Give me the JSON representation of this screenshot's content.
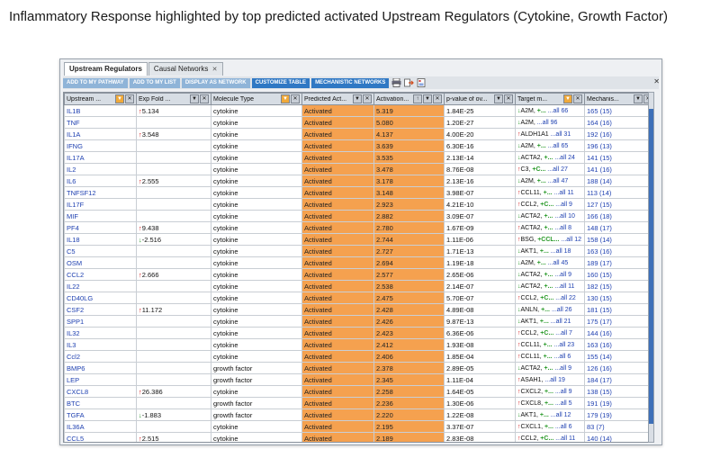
{
  "slide_title": "Inflammatory Response highlighted by top predicted activated Upstream Regulators (Cytokine, Growth Factor)",
  "tabs": [
    {
      "label": "Upstream Regulators",
      "active": true
    },
    {
      "label": "Causal Networks",
      "active": false
    }
  ],
  "tab_close_glyph": "✕",
  "toolbar": {
    "buttons": [
      {
        "label": "ADD TO MY PATHWAY",
        "enabled": false
      },
      {
        "label": "ADD TO MY LIST",
        "enabled": false
      },
      {
        "label": "DISPLAY AS NETWORK",
        "enabled": false
      },
      {
        "label": "CUSTOMIZE TABLE",
        "enabled": true
      },
      {
        "label": "MECHANISTIC NETWORKS",
        "enabled": true
      }
    ],
    "icons": [
      "print-icon",
      "export-icon",
      "report-icon"
    ]
  },
  "columns": [
    "Upstream ...",
    "Exp Fold ...",
    "Molecule Type",
    "Predicted Act...",
    "Activation...",
    "p-value of ov...",
    "Target m...",
    "Mechanis..."
  ],
  "header_buttons": {
    "filter": "▼",
    "close": "✕",
    "sort": "↑"
  },
  "rows": [
    {
      "reg": "IL1B",
      "exp_dir": "up",
      "exp": "5.134",
      "type": "cytokine",
      "pred": "Activated",
      "z": "5.319",
      "p": "1.84E-25",
      "t1": "A2M,",
      "t1d": "down",
      "t2": "+...",
      "tall": "...all 66",
      "mech": "165 (15)"
    },
    {
      "reg": "TNF",
      "exp_dir": "",
      "exp": "",
      "type": "cytokine",
      "pred": "Activated",
      "z": "5.080",
      "p": "1.20E-27",
      "t1": "A2M,",
      "t1d": "down",
      "t2": "",
      "tall": "...all 96",
      "mech": "164 (16)"
    },
    {
      "reg": "IL1A",
      "exp_dir": "up",
      "exp": "3.548",
      "type": "cytokine",
      "pred": "Activated",
      "z": "4.137",
      "p": "4.00E-20",
      "t1": "ALDH1A1",
      "t1d": "up",
      "t2": "",
      "tall": "...all 31",
      "mech": "192 (16)"
    },
    {
      "reg": "IFNG",
      "exp_dir": "",
      "exp": "",
      "type": "cytokine",
      "pred": "Activated",
      "z": "3.639",
      "p": "6.30E-16",
      "t1": "A2M,",
      "t1d": "down",
      "t2": "+...",
      "tall": "...all 65",
      "mech": "196 (13)"
    },
    {
      "reg": "IL17A",
      "exp_dir": "",
      "exp": "",
      "type": "cytokine",
      "pred": "Activated",
      "z": "3.535",
      "p": "2.13E-14",
      "t1": "ACTA2,",
      "t1d": "down",
      "t2": "+...",
      "tall": "...all 24",
      "mech": "141 (15)"
    },
    {
      "reg": "IL2",
      "exp_dir": "",
      "exp": "",
      "type": "cytokine",
      "pred": "Activated",
      "z": "3.478",
      "p": "8.76E-08",
      "t1": "C3,",
      "t1d": "up",
      "t2": "+C...",
      "tall": "...all 27",
      "mech": "141 (16)"
    },
    {
      "reg": "IL6",
      "exp_dir": "up",
      "exp": "2.555",
      "type": "cytokine",
      "pred": "Activated",
      "z": "3.178",
      "p": "2.13E-16",
      "t1": "A2M,",
      "t1d": "down",
      "t2": "+...",
      "tall": "...all 47",
      "mech": "188 (14)"
    },
    {
      "reg": "TNFSF12",
      "exp_dir": "",
      "exp": "",
      "type": "cytokine",
      "pred": "Activated",
      "z": "3.148",
      "p": "3.98E-07",
      "t1": "CCL11,",
      "t1d": "up",
      "t2": "+...",
      "tall": "...all 11",
      "mech": "113 (14)"
    },
    {
      "reg": "IL17F",
      "exp_dir": "",
      "exp": "",
      "type": "cytokine",
      "pred": "Activated",
      "z": "2.923",
      "p": "4.21E-10",
      "t1": "CCL2,",
      "t1d": "up",
      "t2": "+C...",
      "tall": "...all 9",
      "mech": "127 (15)"
    },
    {
      "reg": "MIF",
      "exp_dir": "",
      "exp": "",
      "type": "cytokine",
      "pred": "Activated",
      "z": "2.882",
      "p": "3.09E-07",
      "t1": "ACTA2,",
      "t1d": "down",
      "t2": "+...",
      "tall": "...all 10",
      "mech": "166 (18)"
    },
    {
      "reg": "PF4",
      "exp_dir": "up",
      "exp": "9.438",
      "type": "cytokine",
      "pred": "Activated",
      "z": "2.780",
      "p": "1.67E-09",
      "t1": "ACTA2,",
      "t1d": "up",
      "t2": "+...",
      "tall": "...all 8",
      "mech": "148 (17)"
    },
    {
      "reg": "IL18",
      "exp_dir": "down",
      "exp": "-2.516",
      "type": "cytokine",
      "pred": "Activated",
      "z": "2.744",
      "p": "1.11E-06",
      "t1": "BSG,",
      "t1d": "up",
      "t2": "+CCL...",
      "tall": "...all 12",
      "mech": "158 (14)"
    },
    {
      "reg": "C5",
      "exp_dir": "",
      "exp": "",
      "type": "cytokine",
      "pred": "Activated",
      "z": "2.727",
      "p": "1.71E-13",
      "t1": "AKT1,",
      "t1d": "down",
      "t2": "+...",
      "tall": "...all 18",
      "mech": "163 (16)"
    },
    {
      "reg": "OSM",
      "exp_dir": "",
      "exp": "",
      "type": "cytokine",
      "pred": "Activated",
      "z": "2.694",
      "p": "1.19E-18",
      "t1": "A2M,",
      "t1d": "down",
      "t2": "+...",
      "tall": "...all 45",
      "mech": "189 (17)"
    },
    {
      "reg": "CCL2",
      "exp_dir": "up",
      "exp": "2.666",
      "type": "cytokine",
      "pred": "Activated",
      "z": "2.577",
      "p": "2.65E-06",
      "t1": "ACTA2,",
      "t1d": "down",
      "t2": "+...",
      "tall": "...all 9",
      "mech": "160 (15)"
    },
    {
      "reg": "IL22",
      "exp_dir": "",
      "exp": "",
      "type": "cytokine",
      "pred": "Activated",
      "z": "2.538",
      "p": "2.14E-07",
      "t1": "ACTA2,",
      "t1d": "down",
      "t2": "+...",
      "tall": "...all 11",
      "mech": "182 (15)"
    },
    {
      "reg": "CD40LG",
      "exp_dir": "",
      "exp": "",
      "type": "cytokine",
      "pred": "Activated",
      "z": "2.475",
      "p": "5.70E-07",
      "t1": "CCL2,",
      "t1d": "up",
      "t2": "+C...",
      "tall": "...all 22",
      "mech": "130 (15)"
    },
    {
      "reg": "CSF2",
      "exp_dir": "up",
      "exp": "11.172",
      "type": "cytokine",
      "pred": "Activated",
      "z": "2.428",
      "p": "4.89E-08",
      "t1": "ANLN,",
      "t1d": "down",
      "t2": "+...",
      "tall": "...all 26",
      "mech": "181 (15)"
    },
    {
      "reg": "SPP1",
      "exp_dir": "",
      "exp": "",
      "type": "cytokine",
      "pred": "Activated",
      "z": "2.426",
      "p": "9.87E-13",
      "t1": "AKT1,",
      "t1d": "down",
      "t2": "+...",
      "tall": "...all 21",
      "mech": "175 (17)"
    },
    {
      "reg": "IL32",
      "exp_dir": "",
      "exp": "",
      "type": "cytokine",
      "pred": "Activated",
      "z": "2.423",
      "p": "6.36E-06",
      "t1": "CCL2,",
      "t1d": "up",
      "t2": "+C...",
      "tall": "...all 7",
      "mech": "144 (16)"
    },
    {
      "reg": "IL3",
      "exp_dir": "",
      "exp": "",
      "type": "cytokine",
      "pred": "Activated",
      "z": "2.412",
      "p": "1.93E-08",
      "t1": "CCL11,",
      "t1d": "up",
      "t2": "+...",
      "tall": "...all 23",
      "mech": "163 (16)"
    },
    {
      "reg": "Ccl2",
      "exp_dir": "",
      "exp": "",
      "type": "cytokine",
      "pred": "Activated",
      "z": "2.406",
      "p": "1.85E-04",
      "t1": "CCL11,",
      "t1d": "up",
      "t2": "+...",
      "tall": "...all 6",
      "mech": "155 (14)"
    },
    {
      "reg": "BMP6",
      "exp_dir": "",
      "exp": "",
      "type": "growth factor",
      "pred": "Activated",
      "z": "2.378",
      "p": "2.89E-05",
      "t1": "ACTA2,",
      "t1d": "down",
      "t2": "+...",
      "tall": "...all 9",
      "mech": "126 (16)"
    },
    {
      "reg": "LEP",
      "exp_dir": "",
      "exp": "",
      "type": "growth factor",
      "pred": "Activated",
      "z": "2.345",
      "p": "1.11E-04",
      "t1": "ASAH1,",
      "t1d": "up",
      "t2": "",
      "tall": "...all 19",
      "mech": "184 (17)"
    },
    {
      "reg": "CXCL8",
      "exp_dir": "up",
      "exp": "26.386",
      "type": "cytokine",
      "pred": "Activated",
      "z": "2.258",
      "p": "1.64E-05",
      "t1": "CXCL2,",
      "t1d": "up",
      "t2": "+...",
      "tall": "...all 9",
      "mech": "138 (15)"
    },
    {
      "reg": "BTC",
      "exp_dir": "",
      "exp": "",
      "type": "growth factor",
      "pred": "Activated",
      "z": "2.236",
      "p": "1.30E-06",
      "t1": "CXCL8,",
      "t1d": "up",
      "t2": "+...",
      "tall": "...all 5",
      "mech": "191 (19)"
    },
    {
      "reg": "TGFA",
      "exp_dir": "down",
      "exp": "-1.883",
      "type": "growth factor",
      "pred": "Activated",
      "z": "2.220",
      "p": "1.22E-08",
      "t1": "AKT1,",
      "t1d": "down",
      "t2": "+...",
      "tall": "...all 12",
      "mech": "179 (19)"
    },
    {
      "reg": "IL36A",
      "exp_dir": "",
      "exp": "",
      "type": "cytokine",
      "pred": "Activated",
      "z": "2.195",
      "p": "3.37E-07",
      "t1": "CXCL1,",
      "t1d": "up",
      "t2": "+...",
      "tall": "...all 6",
      "mech": "83 (7)"
    },
    {
      "reg": "CCL5",
      "exp_dir": "up",
      "exp": "2.515",
      "type": "cytokine",
      "pred": "Activated",
      "z": "2.189",
      "p": "2.83E-08",
      "t1": "CCL2,",
      "t1d": "up",
      "t2": "+C...",
      "tall": "...all 11",
      "mech": "140 (14)"
    }
  ],
  "arrows": {
    "up": "↑",
    "down": "↓"
  },
  "colors": {
    "activated": "#f5a14f",
    "up": "#d81b1b",
    "down": "#2a9a2a",
    "link": "#1d3fb0",
    "toolbar_button": "#2f78c4"
  }
}
